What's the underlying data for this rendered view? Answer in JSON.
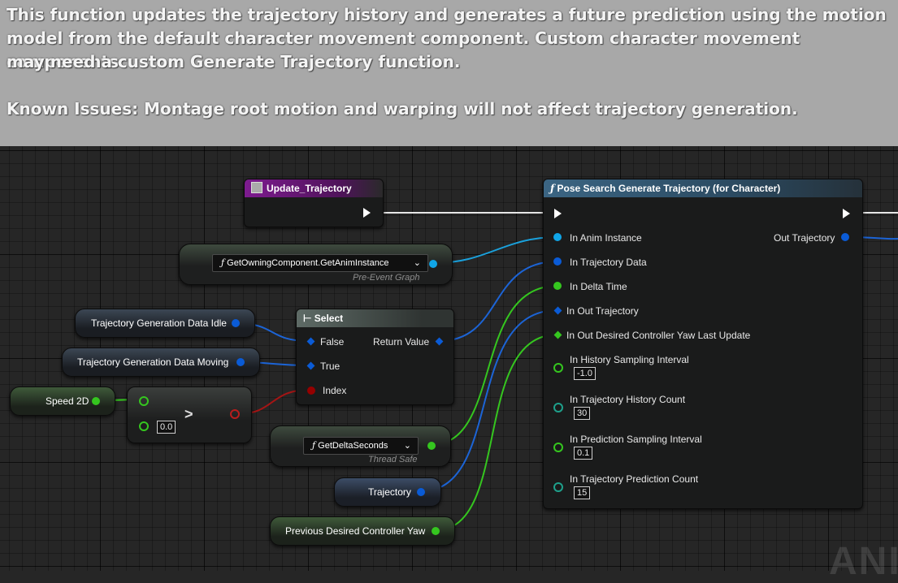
{
  "comment": {
    "line1": "This function updates the trajectory history and generates a future prediction using the motion",
    "line2": "model from the default character movement component. Custom character movement components",
    "line3": "may need a custom Generate Trajectory function.",
    "line4": "Known Issues: Montage root motion and warping will not affect trajectory generation."
  },
  "event_node": {
    "title": "Update_Trajectory"
  },
  "anim_instance_node": {
    "label": "GetOwningComponent.GetAnimInstance",
    "sub": "Pre-Event Graph"
  },
  "select_node": {
    "title": "Select",
    "pins": {
      "false": "False",
      "true": "True",
      "index": "Index",
      "return": "Return Value"
    }
  },
  "idle_var": {
    "label": "Trajectory Generation Data Idle"
  },
  "moving_var": {
    "label": "Trajectory Generation Data Moving"
  },
  "speed_var": {
    "label": "Speed 2D"
  },
  "compare_node": {
    "op": ">",
    "value": "0.0"
  },
  "delta_node": {
    "label": "GetDeltaSeconds",
    "sub": "Thread Safe"
  },
  "trajectory_var": {
    "label": "Trajectory"
  },
  "yaw_var": {
    "label": "Previous Desired Controller Yaw"
  },
  "generate_node": {
    "title": "Pose Search Generate Trajectory (for Character)",
    "inputs": {
      "anim": "In Anim Instance",
      "data": "In Trajectory Data",
      "delta": "In Delta Time",
      "out_traj": "In Out Trajectory",
      "yaw": "In Out Desired Controller Yaw Last Update",
      "hist_interval": "In History Sampling Interval",
      "hist_count": "In Trajectory History Count",
      "pred_interval": "In Prediction Sampling Interval",
      "pred_count": "In Trajectory Prediction Count"
    },
    "values": {
      "hist_interval": "-1.0",
      "hist_count": "30",
      "pred_interval": "0.1",
      "pred_count": "15"
    },
    "output": "Out Trajectory"
  },
  "watermark": "ANI",
  "colors": {
    "object_pin": "#10a6e8",
    "struct_pin": "#0a5bd6",
    "float_pin": "#35c61f",
    "bool_pin": "#950000",
    "teal_pin": "#1ea08b",
    "event_header": "#7b1a8c",
    "function_header": "#3f6d8f",
    "select_header": "#6c6c6c"
  }
}
